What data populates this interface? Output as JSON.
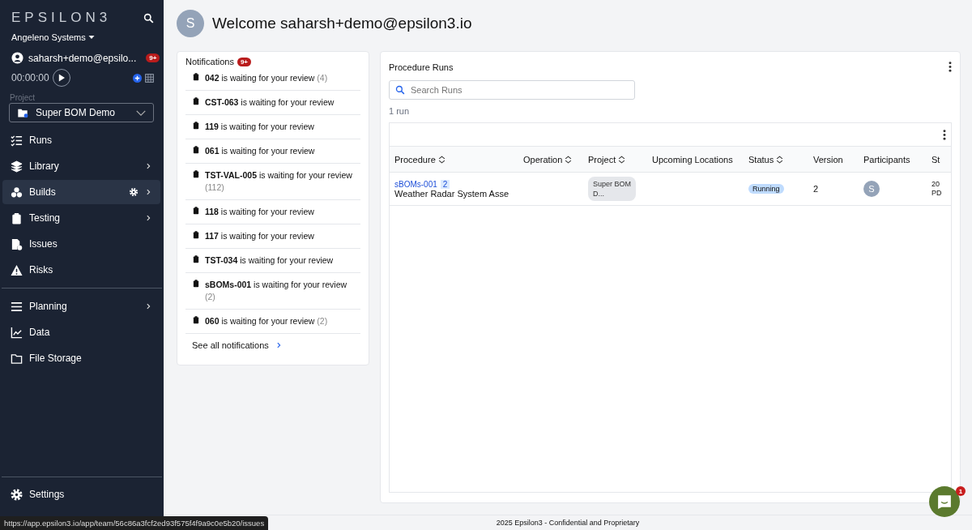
{
  "sidebar": {
    "logo": "EPSILON3",
    "team": "Angeleno Systems",
    "user": "saharsh+demo@epsilo...",
    "user_badge": "9+",
    "timer": "00:00:00",
    "project_label": "Project",
    "project": "Super BOM Demo",
    "nav": [
      {
        "label": "Runs",
        "selected": false,
        "chevron": false,
        "gear": false
      },
      {
        "label": "Library",
        "selected": false,
        "chevron": true,
        "gear": false
      },
      {
        "label": "Builds",
        "selected": true,
        "chevron": true,
        "gear": true
      },
      {
        "label": "Testing",
        "selected": false,
        "chevron": true,
        "gear": false
      },
      {
        "label": "Issues",
        "selected": false,
        "chevron": false,
        "gear": false
      },
      {
        "label": "Risks",
        "selected": false,
        "chevron": false,
        "gear": false
      },
      {
        "label": "Planning",
        "selected": false,
        "chevron": true,
        "gear": false,
        "divider": true
      },
      {
        "label": "Data",
        "selected": false,
        "chevron": false,
        "gear": false
      },
      {
        "label": "File Storage",
        "selected": false,
        "chevron": false,
        "gear": false
      }
    ],
    "bottom": [
      {
        "label": "Settings"
      }
    ]
  },
  "header": {
    "avatar": "S",
    "title": "Welcome saharsh+demo@epsilon3.io"
  },
  "notifications": {
    "title": "Notifications",
    "badge": "9+",
    "items": [
      {
        "id": "042",
        "text": "is waiting for your review",
        "count": "(4)"
      },
      {
        "id": "CST-063",
        "text": "is waiting for your review"
      },
      {
        "id": "119",
        "text": "is waiting for your review"
      },
      {
        "id": "061",
        "text": "is waiting for your review"
      },
      {
        "id": "TST-VAL-005",
        "text": "is waiting for your review",
        "count": "(112)"
      },
      {
        "id": "118",
        "text": "is waiting for your review"
      },
      {
        "id": "117",
        "text": "is waiting for your review"
      },
      {
        "id": "TST-034",
        "text": "is waiting for your review"
      },
      {
        "id": "sBOMs-001",
        "text": "is waiting for your review",
        "count": "(2)"
      },
      {
        "id": "060",
        "text": "is waiting for your review",
        "count": "(2)"
      }
    ],
    "see_all": "See all notifications"
  },
  "runs": {
    "title": "Procedure Runs",
    "search_placeholder": "Search Runs",
    "count": "1 run",
    "columns": [
      {
        "label": "Procedure",
        "sortable": true
      },
      {
        "label": "Operation",
        "sortable": true
      },
      {
        "label": "Project",
        "sortable": true
      },
      {
        "label": "Upcoming Locations",
        "sortable": false
      },
      {
        "label": "Status",
        "sortable": true
      },
      {
        "label": "Version",
        "sortable": false
      },
      {
        "label": "Participants",
        "sortable": false
      },
      {
        "label": "St",
        "sortable": false
      }
    ],
    "rows": [
      {
        "procedure_id": "sBOMs-001",
        "procedure_badge": "2",
        "procedure_name": "Weather Radar System Asse",
        "project": "Super BOM D...",
        "status": "Running",
        "version": "2",
        "participant": "S",
        "column_8": [
          "20",
          "PD"
        ]
      }
    ]
  },
  "footer": "2025 Epsilon3 - Confidential and Proprietary",
  "status_url": "https://app.epsilon3.io/app/team/56c86a3fcf2ed93f575f4f9a9c0e5b20/issues",
  "chat": {
    "badge": "1"
  }
}
